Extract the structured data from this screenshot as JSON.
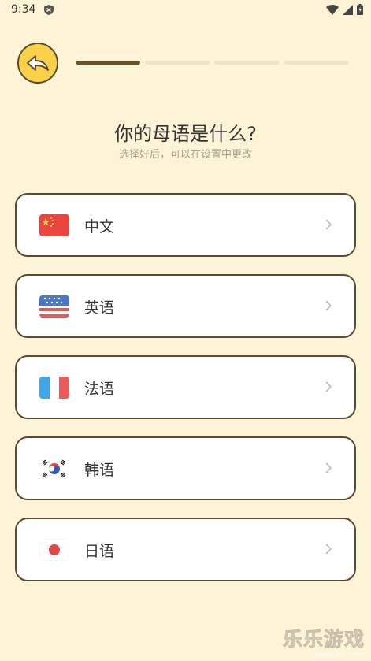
{
  "status": {
    "time": "9:34"
  },
  "header": {
    "progress_steps": 4,
    "progress_current": 1
  },
  "title": "你的母语是什么?",
  "subtitle": "选择好后，可以在设置中更改",
  "languages": [
    {
      "label": "中文",
      "flag": "china-flag"
    },
    {
      "label": "英语",
      "flag": "usa-flag"
    },
    {
      "label": "法语",
      "flag": "france-flag"
    },
    {
      "label": "韩语",
      "flag": "korea-flag"
    },
    {
      "label": "日语",
      "flag": "japan-flag"
    }
  ],
  "watermark": {
    "text": "乐乐游戏",
    "url": "www.6ll.com"
  },
  "colors": {
    "background": "#fdf3d6",
    "accent": "#fbd14b",
    "border": "#5b4930",
    "progress": "#6b5323"
  }
}
